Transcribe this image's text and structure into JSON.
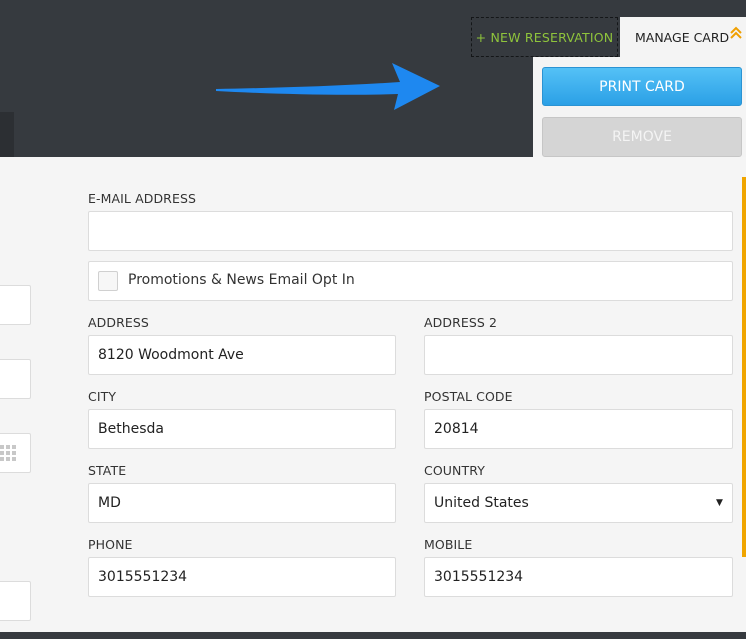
{
  "header": {
    "new_reservation_label": "+ NEW RESERVATION",
    "manage_card_label": "MANAGE CARD",
    "manage_card_icon": "chevron-double-up-icon"
  },
  "manage_menu": {
    "print_label": "PRINT CARD",
    "remove_label": "REMOVE"
  },
  "form": {
    "email": {
      "label": "E-MAIL ADDRESS",
      "value": ""
    },
    "optin": {
      "label": "Promotions & News Email Opt In",
      "checked": false
    },
    "address": {
      "label": "ADDRESS",
      "value": "8120 Woodmont Ave"
    },
    "address2": {
      "label": "ADDRESS 2",
      "value": ""
    },
    "city": {
      "label": "CITY",
      "value": "Bethesda"
    },
    "postal": {
      "label": "POSTAL CODE",
      "value": "20814"
    },
    "state": {
      "label": "STATE",
      "value": "MD"
    },
    "country": {
      "label": "COUNTRY",
      "value": "United States"
    },
    "phone": {
      "label": "PHONE",
      "value": "3015551234"
    },
    "mobile": {
      "label": "MOBILE",
      "value": "3015551234"
    }
  },
  "colors": {
    "topbar": "#363a3f",
    "accent_green": "#8fc43c",
    "print_blue": "#2ba0e6",
    "accent_orange": "#f0a500",
    "annotation_arrow": "#1e88f0"
  }
}
